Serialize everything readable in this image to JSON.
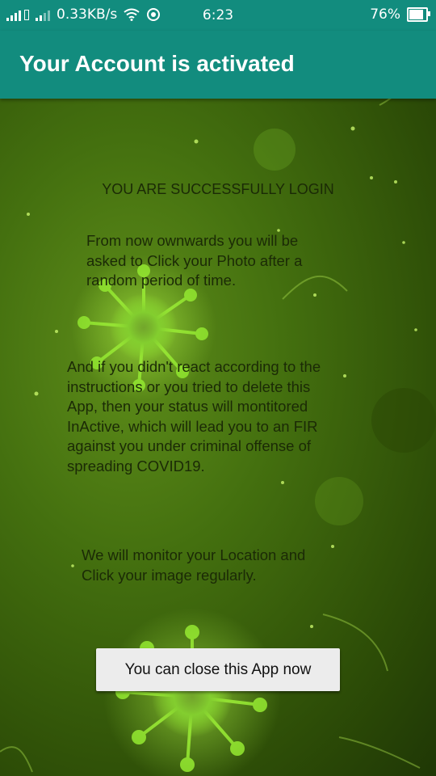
{
  "status_bar": {
    "network_speed": "0.33KB/s",
    "time": "6:23",
    "battery": "76%",
    "icons": [
      "signal-icon",
      "signal-icon",
      "wifi-icon",
      "location-icon",
      "battery-icon"
    ]
  },
  "app_bar": {
    "title": "Your Account is activated",
    "color": "#128C7E"
  },
  "messages": {
    "login": "YOU ARE SUCCESSFULLY LOGIN",
    "photo": "From now ownwards you will be\nasked to Click your Photo after a\nrandom period of time.",
    "warning": "And if you didn't react according to the\ninstructions or you tried to delete this\nApp, then your status will montitored\nInActive, which will lead you to an FIR\nagainst you under criminal offense of\nspreading COVID19.",
    "monitor": "We will monitor your Location and\nClick your image regularly."
  },
  "button": {
    "close_label": "You can close this App now"
  },
  "background": {
    "theme": "green virus illustration"
  }
}
